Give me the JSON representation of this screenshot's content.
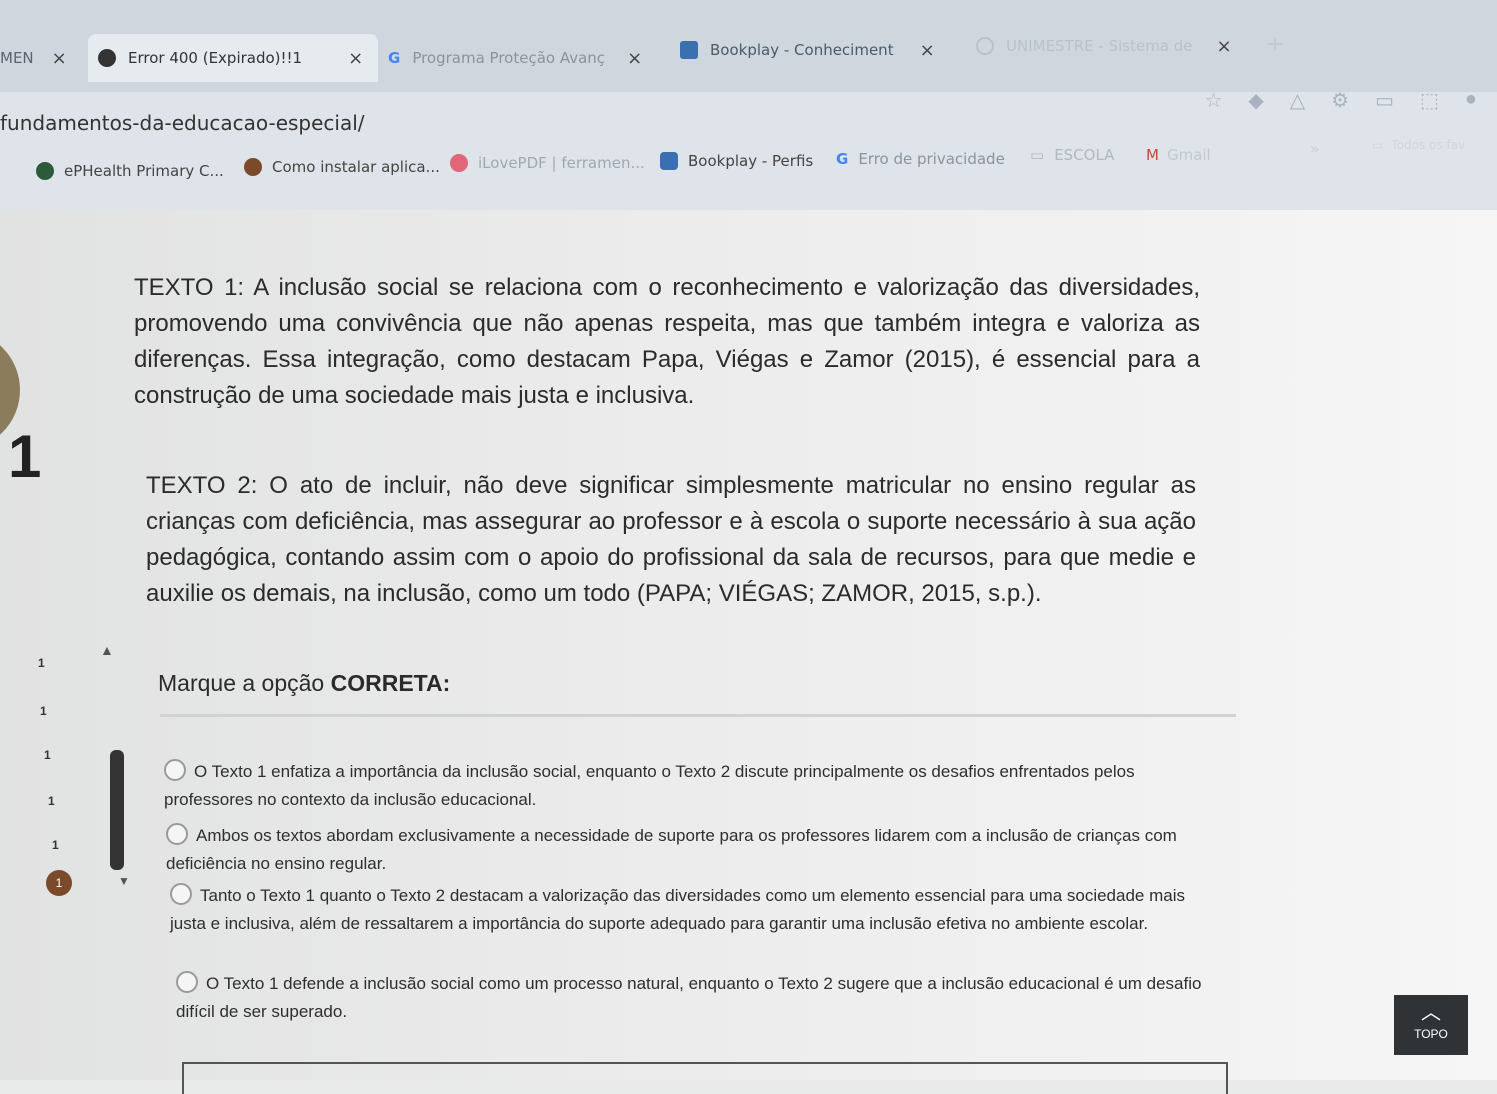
{
  "tabs": [
    {
      "label": "MEN",
      "close": "×"
    },
    {
      "label": "Error 400 (Expirado)!!1",
      "close": "×"
    },
    {
      "label": "Programa Proteção Avanç",
      "close": "×"
    },
    {
      "label": "Bookplay - Conheciment",
      "close": "×"
    },
    {
      "label": "UNIMESTRE - Sistema de",
      "close": "×"
    }
  ],
  "new_tab": "+",
  "address": {
    "url": "fundamentos-da-educacao-especial/"
  },
  "bookmarks": [
    {
      "label": "ePHealth Primary C...",
      "color": "#2d5a3a"
    },
    {
      "label": "Como instalar aplica...",
      "color": "#7a4a2a"
    },
    {
      "label": "iLovePDF | ferramen...",
      "color": "#e0677a"
    },
    {
      "label": "Bookplay - Perfis",
      "color": "#3a6fb0"
    },
    {
      "label": "Erro de privacidade",
      "color": "#4285f4"
    },
    {
      "label": "ESCOLA",
      "color": "#9aa3ad"
    },
    {
      "label": "Gmail",
      "color": "#c5483a"
    },
    {
      "label": "Todos os fav",
      "color": "#9aa3ad"
    }
  ],
  "question": {
    "number": "1",
    "text1": "TEXTO 1: A inclusão social se relaciona com o reconhecimento e valorização das diversidades, promovendo uma convivência que não apenas respeita, mas que também integra e valoriza as diferenças. Essa integração, como destacam Papa, Viégas e Zamor (2015), é essencial para a construção de uma sociedade mais justa e inclusiva.",
    "text2": "TEXTO 2: O ato de incluir, não deve significar simplesmente matricular no ensino regular as crianças com deficiência, mas assegurar ao professor e à escola o suporte necessário à sua ação pedagógica, contando assim com o apoio do profissional da sala de recursos, para que medie e auxilie os demais, na inclusão, como um todo (PAPA; VIÉGAS; ZAMOR, 2015, s.p.).",
    "prompt_prefix": "Marque a opção ",
    "prompt_bold": "CORRETA:",
    "options": [
      "O Texto 1 enfatiza a importância da inclusão social, enquanto o Texto 2 discute principalmente os desafios enfrentados pelos professores no contexto da inclusão educacional.",
      "Ambos os textos abordam exclusivamente a necessidade de suporte para os professores lidarem com a inclusão de crianças com deficiência no ensino regular.",
      "Tanto o Texto 1 quanto o Texto 2 destacam a valorização das diversidades como um elemento essencial para uma sociedade mais justa e inclusiva, além de ressaltarem a importância do suporte adequado para garantir uma inclusão efetiva no ambiente escolar.",
      "O Texto 1 defende a inclusão social como um processo natural, enquanto o Texto 2 sugere que a inclusão educacional é um desafio difícil de ser superado."
    ]
  },
  "nav_numbers": [
    "1",
    "1",
    "1",
    "1",
    "1",
    "1"
  ],
  "topo_label": "TOPO"
}
